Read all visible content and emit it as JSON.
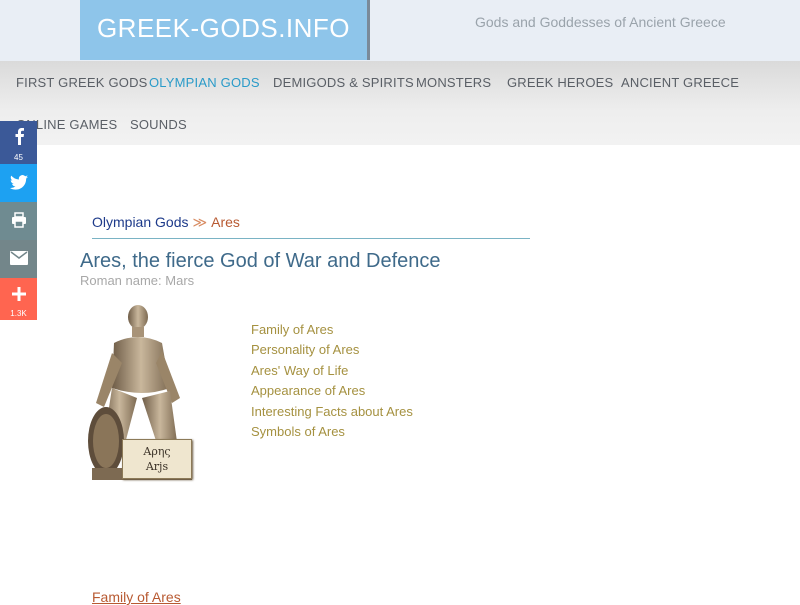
{
  "header": {
    "logo": "GREEK-GODS.INFO",
    "tagline": "Gods and Goddesses of Ancient Greece"
  },
  "nav": {
    "items": [
      {
        "label": "FIRST GREEK GODS"
      },
      {
        "label": "OLYMPIAN GODS",
        "active": true
      },
      {
        "label": "DEMIGODS & SPIRITS"
      },
      {
        "label": "MONSTERS"
      },
      {
        "label": "GREEK HEROES"
      },
      {
        "label": "ANCIENT GREECE"
      },
      {
        "label": "ONLINE GAMES"
      },
      {
        "label": "SOUNDS"
      }
    ],
    "active_color": "#2a9bc9"
  },
  "social": {
    "facebook_count": "45",
    "share_count": "1.3K",
    "colors": {
      "facebook": "#3b5998",
      "twitter": "#1da1f2",
      "print": "#6f8b91",
      "email": "#73868a",
      "share": "#ff6550"
    }
  },
  "breadcrumb": {
    "parent": "Olympian Gods",
    "separator": "≫",
    "current": "Ares"
  },
  "page": {
    "title": "Ares, the fierce God of War and Defence",
    "subtitle": "Roman name: Mars",
    "statue_inscription_line1": "Αρης",
    "statue_inscription_line2": "Arjs"
  },
  "toc": [
    "Family of Ares",
    "Personality of Ares",
    "Ares' Way of Life",
    "Appearance of Ares",
    "Interesting Facts about Ares",
    "Symbols of Ares"
  ],
  "section": {
    "heading": "Family of Ares"
  }
}
